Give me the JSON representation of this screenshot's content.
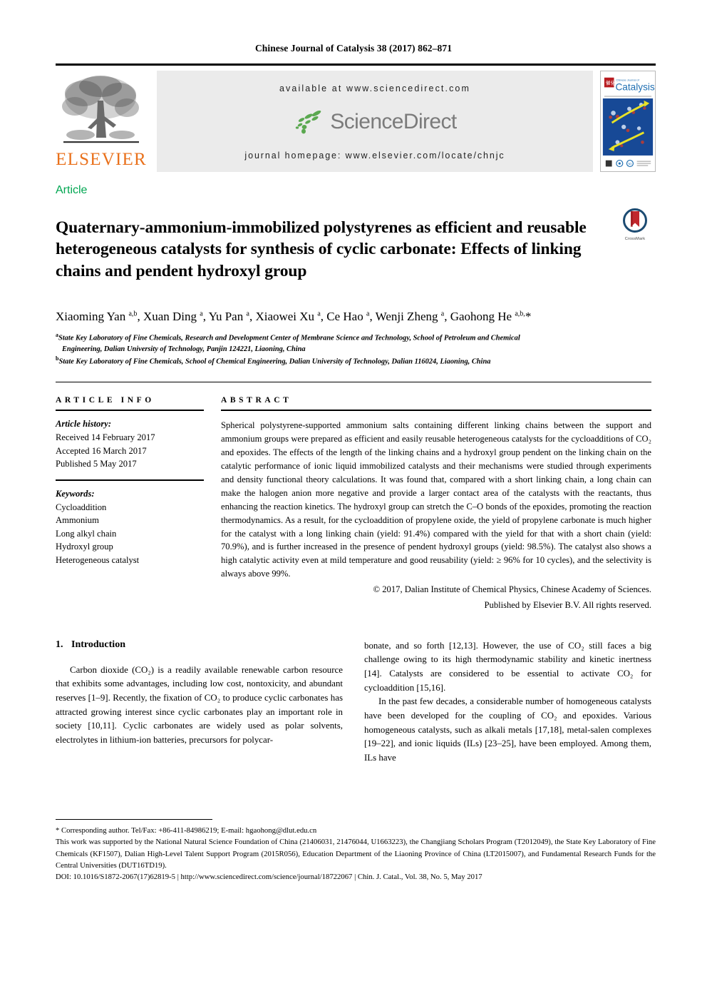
{
  "running_head": "Chinese Journal of Catalysis 38 (2017) 862–871",
  "masthead": {
    "publisher_name": "ELSEVIER",
    "available_at": "available at www.sciencedirect.com",
    "sciencedirect_logo_text": "ScienceDirect",
    "journal_homepage": "journal homepage: www.elsevier.com/locate/chnjc",
    "cover_title": "Catalysis",
    "cover_title_small": "Chinese Journal of"
  },
  "article_type": "Article",
  "title": "Quaternary-ammonium-immobilized polystyrenes as efficient and reusable heterogeneous catalysts for synthesis of cyclic carbonate: Effects of linking chains and pendent hydroxyl group",
  "crossmark_label": "CrossMark",
  "authors_html": "Xiaoming Yan <sup>a,b</sup>, Xuan Ding <sup>a</sup>, Yu Pan <sup>a</sup>, Xiaowei Xu <sup>a</sup>, Ce Hao <sup>a</sup>, Wenji Zheng <sup>a</sup>, Gaohong He <sup>a,b,</sup>*",
  "affiliations": [
    {
      "marker": "a",
      "line1": "State Key Laboratory of Fine Chemicals, Research and Development Center of Membrane Science and Technology, School of Petroleum and Chemical",
      "line2": "Engineering, Dalian University of Technology, Panjin 124221, Liaoning, China"
    },
    {
      "marker": "b",
      "line1": "State Key Laboratory of Fine Chemicals, School of Chemical Engineering, Dalian University of Technology, Dalian 116024, Liaoning, China",
      "line2": ""
    }
  ],
  "article_info": {
    "heading": "ARTICLE INFO",
    "history_label": "Article history:",
    "history": [
      "Received 14 February 2017",
      "Accepted 16 March 2017",
      "Published 5 May 2017"
    ],
    "keywords_label": "Keywords:",
    "keywords": [
      "Cycloaddition",
      "Ammonium",
      "Long alkyl chain",
      "Hydroxyl group",
      "Heterogeneous catalyst"
    ]
  },
  "abstract": {
    "heading": "ABSTRACT",
    "body": "Spherical polystyrene-supported ammonium salts containing different linking chains between the support and ammonium groups were prepared as efficient and easily reusable heterogeneous catalysts for the cycloadditions of CO₂ and epoxides. The effects of the length of the linking chains and a hydroxyl group pendent on the linking chain on the catalytic performance of ionic liquid immobilized catalysts and their mechanisms were studied through experiments and density functional theory calculations. It was found that, compared with a short linking chain, a long chain can make the halogen anion more negative and provide a larger contact area of the catalysts with the reactants, thus enhancing the reaction kinetics. The hydroxyl group can stretch the C–O bonds of the epoxides, promoting the reaction thermodynamics. As a result, for the cycloaddition of propylene oxide, the yield of propylene carbonate is much higher for the catalyst with a long linking chain (yield: 91.4%) compared with the yield for that with a short chain (yield: 70.9%), and is further increased in the presence of pendent hydroxyl groups (yield: 98.5%). The catalyst also shows a high catalytic activity even at mild temperature and good reusability (yield: ≥ 96% for 10 cycles), and the selectivity is always above 99%.",
    "copyright_line1": "© 2017, Dalian Institute of Chemical Physics, Chinese Academy of Sciences.",
    "copyright_line2": "Published by Elsevier B.V. All rights reserved."
  },
  "section": {
    "number": "1.",
    "heading": "Introduction"
  },
  "body_left": "Carbon dioxide (CO₂) is a readily available renewable carbon resource that exhibits some advantages, including low cost, nontoxicity, and abundant reserves [1–9]. Recently, the fixation of CO₂ to produce cyclic carbonates has attracted growing interest since cyclic carbonates play an important role in society [10,11]. Cyclic carbonates are widely used as polar solvents, electrolytes in lithium-ion batteries, precursors for polycar-",
  "body_right_para1": "bonate, and so forth [12,13]. However, the use of CO₂ still faces a big challenge owing to its high thermodynamic stability and kinetic inertness [14]. Catalysts are considered to be essential to activate CO₂ for cycloaddition [15,16].",
  "body_right_para2": "In the past few decades, a considerable number of homogeneous catalysts have been developed for the coupling of CO₂ and epoxides. Various homogeneous catalysts, such as alkali metals [17,18], metal-salen complexes [19–22], and ionic liquids (ILs) [23–25], have been employed. Among them, ILs have",
  "footnotes": {
    "corresponding": "* Corresponding author. Tel/Fax: +86-411-84986219; E-mail: hgaohong@dlut.edu.cn",
    "funding": "This work was supported by the National Natural Science Foundation of China (21406031, 21476044, U1663223), the Changjiang Scholars Program (T2012049), the State Key Laboratory of Fine Chemicals (KF1507), Dalian High-Level Talent Support Program (2015R056), Education Department of the Liaoning Province of China (LT2015007), and Fundamental Research Funds for the Central Universities (DUT16TD19).",
    "doi_line": "DOI: 10.1016/S1872-2067(17)62819-5 | http://www.sciencedirect.com/science/journal/18722067 | Chin. J. Catal., Vol. 38, No. 5, May 2017"
  },
  "colors": {
    "article_green": "#00a651",
    "elsevier_orange": "#E9711C",
    "sciencedirect_gray": "#7b7b7b",
    "sciencedirect_green": "#5aa84f",
    "banner_bg": "#ebebeb",
    "crossmark_blue": "#1c4b72",
    "crossmark_red": "#c1272d"
  }
}
